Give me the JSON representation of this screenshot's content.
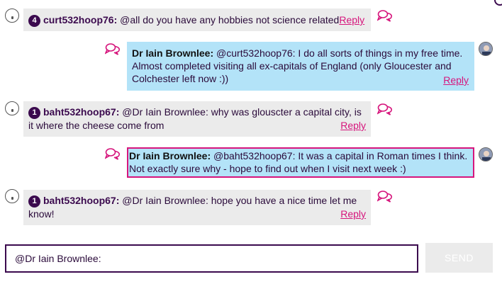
{
  "messages": [
    {
      "badge": "4",
      "user": "curt532hoop76:",
      "text": "@all do you have any hobbies not science related",
      "reply": "Reply"
    },
    {
      "user": "Dr Iain Brownlee:",
      "text": "@curt532hoop76: I do all sorts of things in my free time. Almost completed visiting all ex-capitals of England (only Gloucester and Colchester left now :))",
      "reply": "Reply"
    },
    {
      "badge": "1",
      "user": "baht532hoop67:",
      "text": "@Dr Iain Brownlee: why was glouscter a capital city, is it where the cheese come from",
      "reply": "Reply"
    },
    {
      "user": "Dr Iain Brownlee:",
      "text": "@baht532hoop67: It was a capital in Roman times I think. Not exactly sure why - hope to find out when I visit next week :)"
    },
    {
      "badge": "1",
      "user": "baht532hoop67:",
      "text": "@Dr Iain Brownlee: hope you have a nice time let me know!",
      "reply": "Reply"
    }
  ],
  "composer": {
    "value": "@Dr Iain Brownlee:",
    "send_label": "SEND"
  },
  "colors": {
    "accent": "#d6157c",
    "brand": "#3b0a4e",
    "staff_bubble": "#b3e3f8",
    "student_bubble": "#ebebeb"
  },
  "icons": {
    "student_avatar": "anonymous-avatar-icon",
    "staff_avatar": "staff-photo-avatar",
    "reply_action": "chat-bubbles-icon"
  }
}
